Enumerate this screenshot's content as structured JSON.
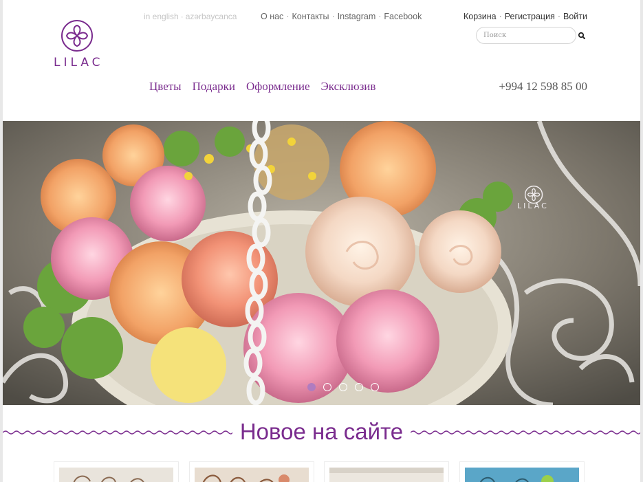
{
  "brand": {
    "name": "LILAC",
    "color": "#7a2c8e"
  },
  "language": {
    "english": "in english",
    "azerbaijani": "azərbaycanca",
    "separator": "·"
  },
  "top_nav": [
    {
      "label": "О нас"
    },
    {
      "label": "Контакты"
    },
    {
      "label": "Instagram"
    },
    {
      "label": "Facebook"
    }
  ],
  "user_nav": [
    {
      "label": "Корзина"
    },
    {
      "label": "Регистрация"
    },
    {
      "label": "Войти"
    }
  ],
  "search": {
    "placeholder": "Поиск",
    "icon": "search-icon"
  },
  "main_menu": [
    {
      "label": "Цветы"
    },
    {
      "label": "Подарки"
    },
    {
      "label": "Оформление"
    },
    {
      "label": "Эксклюзив"
    }
  ],
  "phone": "+994 12 598 85 00",
  "hero": {
    "watermark": "LILAC",
    "slides_total": 5,
    "active_slide": 1,
    "accent_color": "#b07cc0"
  },
  "section": {
    "title": "Новое на сайте"
  },
  "products": [
    {
      "name": "product-1"
    },
    {
      "name": "product-2"
    },
    {
      "name": "product-3"
    },
    {
      "name": "product-4"
    }
  ]
}
